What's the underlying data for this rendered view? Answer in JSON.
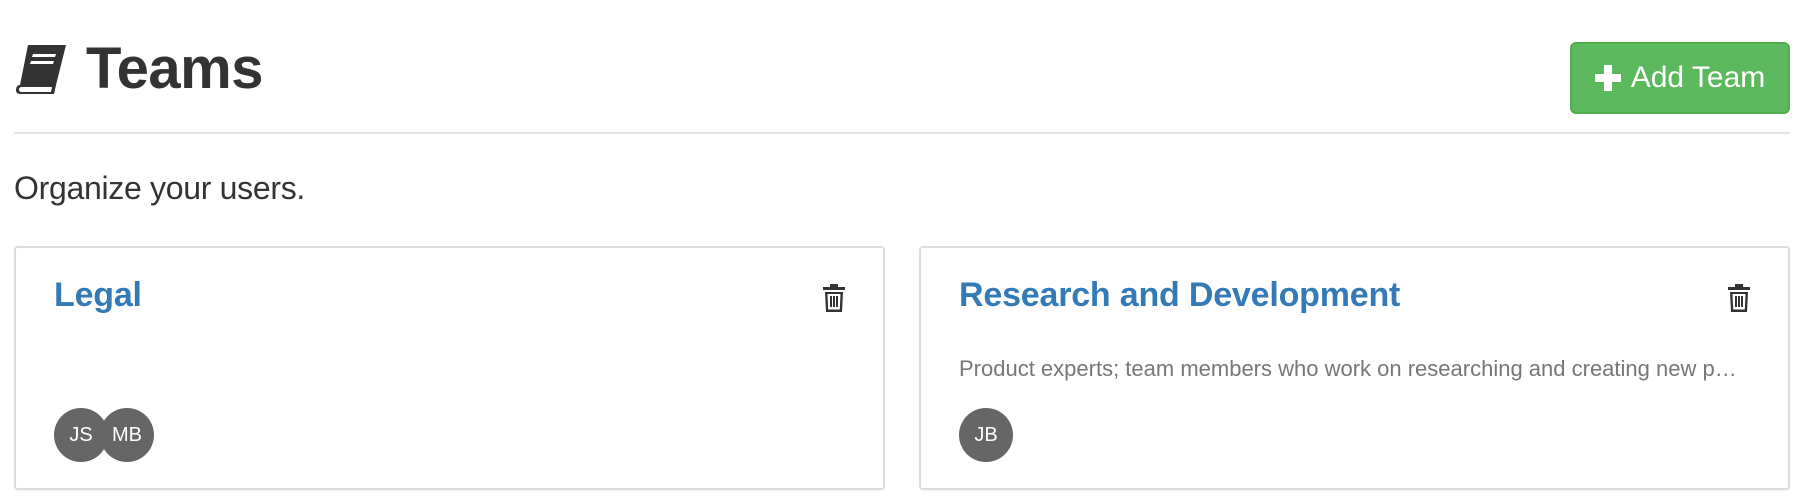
{
  "header": {
    "title": "Teams",
    "title_icon": "book-icon",
    "add_button_label": "Add Team",
    "add_button_icon": "plus-icon",
    "add_button_color": "#5cb85c"
  },
  "subtitle": "Organize your users.",
  "teams": [
    {
      "name": "Legal",
      "description": "",
      "members": [
        "JS",
        "MB"
      ]
    },
    {
      "name": "Research and Development",
      "description": "Product experts; team members who work on researching and creating new p…",
      "members": [
        "JB"
      ]
    }
  ],
  "colors": {
    "link": "#337ab7",
    "avatar": "#666666",
    "text": "#333333",
    "muted": "#777777"
  }
}
